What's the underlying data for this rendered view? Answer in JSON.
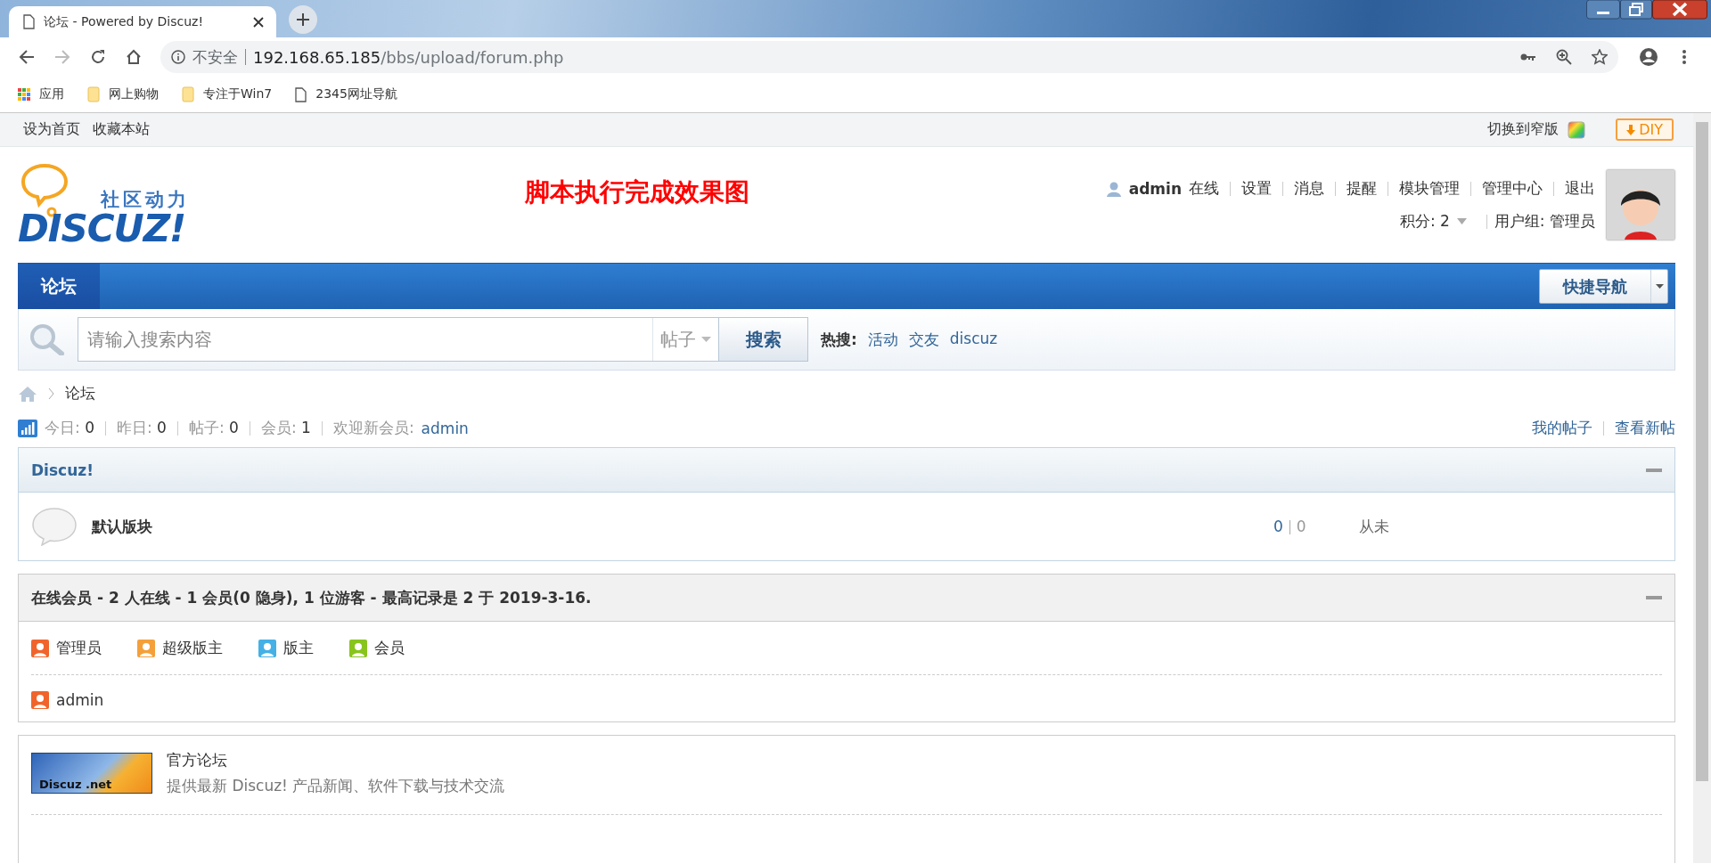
{
  "browser": {
    "tab_title": "论坛 - Powered by Discuz!",
    "security": "不安全",
    "url_host": "192.168.65.185",
    "url_path": "/bbs/upload/forum.php",
    "bookmarks": [
      {
        "label": "应用",
        "kind": "apps"
      },
      {
        "label": "网上购物",
        "kind": "folder"
      },
      {
        "label": "专注于Win7",
        "kind": "folder"
      },
      {
        "label": "2345网址导航",
        "kind": "page"
      }
    ]
  },
  "topbar": {
    "links": [
      "设为首页",
      "收藏本站"
    ],
    "switch_label": "切换到窄版",
    "diy_button": "DIY"
  },
  "header": {
    "logo_tagline": "社区动力",
    "logo_name": "DISCUZ!",
    "headline": "脚本执行完成效果图",
    "user": {
      "name": "admin",
      "status": "在线",
      "links": [
        "设置",
        "消息",
        "提醒",
        "模块管理",
        "管理中心",
        "退出"
      ],
      "credits_label": "积分:",
      "credits": "2",
      "group_label": "用户组:",
      "group": "管理员"
    }
  },
  "nav": {
    "items": [
      {
        "label": "论坛",
        "selected": true
      }
    ],
    "quick_nav": "快捷导航"
  },
  "search": {
    "placeholder": "请输入搜索内容",
    "scope": "帖子",
    "button": "搜索",
    "hot_label": "热搜:",
    "hot": [
      "活动",
      "交友",
      "discuz"
    ]
  },
  "breadcrumb": [
    "论坛"
  ],
  "stats": {
    "items": [
      {
        "label": "今日:",
        "value": "0"
      },
      {
        "label": "昨日:",
        "value": "0"
      },
      {
        "label": "帖子:",
        "value": "0"
      },
      {
        "label": "会员:",
        "value": "1"
      }
    ],
    "welcome_label": "欢迎新会员:",
    "welcome_user": "admin",
    "links": [
      "我的帖子",
      "查看新帖"
    ]
  },
  "categories": [
    {
      "title": "Discuz!",
      "forums": [
        {
          "name": "默认版块",
          "threads": "0",
          "posts": "0",
          "last_post": "从未"
        }
      ]
    }
  ],
  "online": {
    "title": "在线会员 - 2 人在线 - 1 会员(0 隐身), 1 位游客 - 最高记录是 2 于 2019-3-16.",
    "legend": [
      {
        "label": "管理员",
        "color": "#f0642c"
      },
      {
        "label": "超级版主",
        "color": "#f4a03a"
      },
      {
        "label": "版主",
        "color": "#45b0e6"
      },
      {
        "label": "会员",
        "color": "#88c41c"
      }
    ],
    "members": [
      {
        "name": "admin",
        "color": "#f0642c"
      }
    ]
  },
  "friend_links": [
    {
      "logo": "Discuz .net",
      "name": "官方论坛",
      "description": "提供最新 Discuz! 产品新闻、软件下载与技术交流"
    }
  ]
}
